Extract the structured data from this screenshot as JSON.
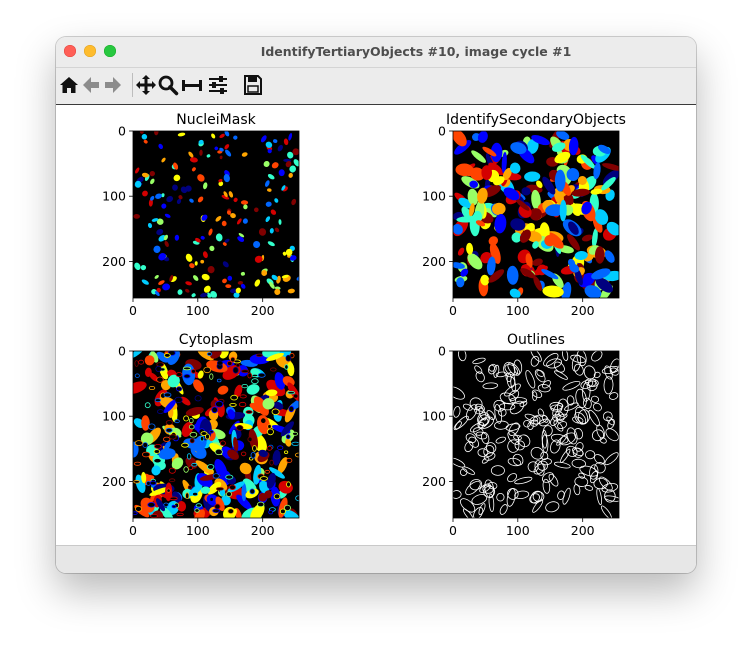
{
  "window": {
    "title": "IdentifyTertiaryObjects #10, image cycle #1"
  },
  "toolbar": {
    "buttons": [
      {
        "name": "home",
        "icon": "home-icon"
      },
      {
        "name": "back",
        "icon": "back-arrow-icon"
      },
      {
        "name": "forward",
        "icon": "forward-arrow-icon"
      },
      {
        "name": "pan",
        "icon": "pan-icon"
      },
      {
        "name": "zoom",
        "icon": "zoom-icon"
      },
      {
        "name": "configure-subplots",
        "icon": "subplots-icon"
      },
      {
        "name": "edit-parameters",
        "icon": "sliders-icon"
      },
      {
        "name": "save",
        "icon": "save-icon"
      }
    ]
  },
  "panels": [
    {
      "title": "NucleiMask",
      "style": "nuclei",
      "xticks": [
        "0",
        "100",
        "200"
      ],
      "yticks": [
        "0",
        "100",
        "200"
      ]
    },
    {
      "title": "IdentifySecondaryObjects",
      "style": "secondary",
      "xticks": [
        "0",
        "100",
        "200"
      ],
      "yticks": [
        "0",
        "100",
        "200"
      ]
    },
    {
      "title": "Cytoplasm",
      "style": "cytoplasm",
      "xticks": [
        "0",
        "100",
        "200"
      ],
      "yticks": [
        "0",
        "100",
        "200"
      ]
    },
    {
      "title": "Outlines",
      "style": "outlines",
      "xticks": [
        "0",
        "100",
        "200"
      ],
      "yticks": [
        "0",
        "100",
        "200"
      ]
    }
  ],
  "image_extent": [
    0,
    256
  ],
  "colormap": [
    "#00007f",
    "#0000ff",
    "#0066ff",
    "#00ccff",
    "#33ffcc",
    "#99ff66",
    "#ffff00",
    "#ffa500",
    "#ff4400",
    "#d40000",
    "#800000"
  ],
  "outline_color": "#ffffff",
  "background_color": "#000000"
}
